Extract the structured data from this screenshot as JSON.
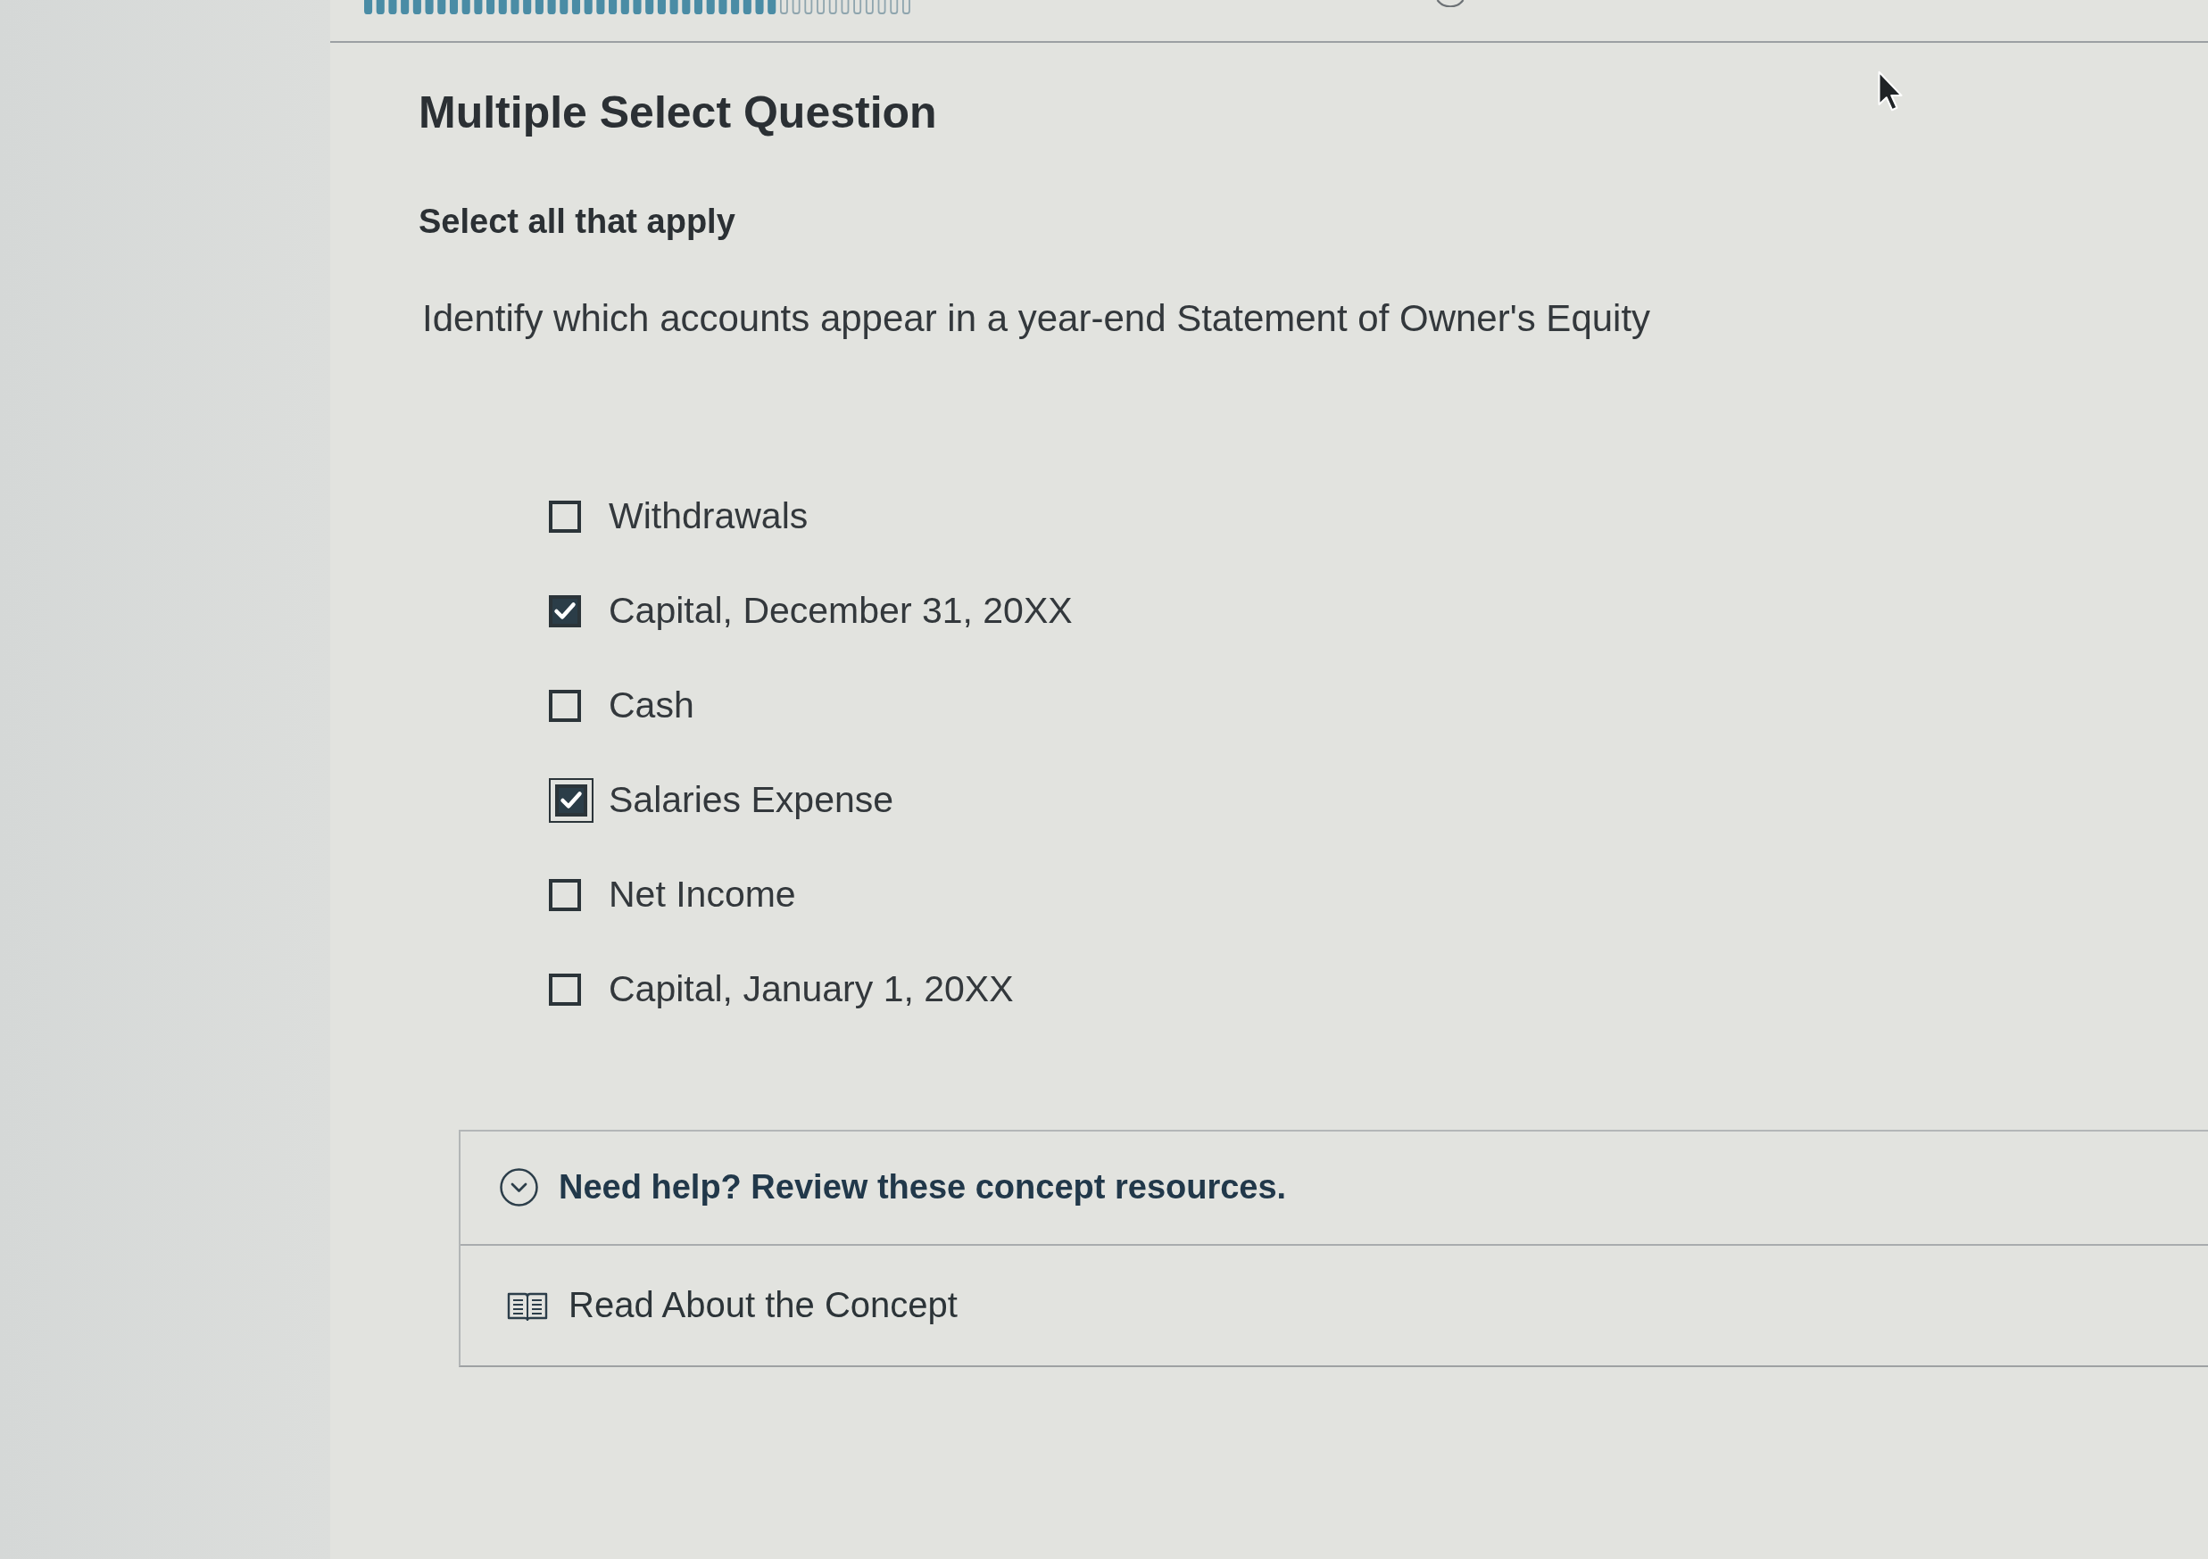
{
  "progress": {
    "level": 0.76
  },
  "title": "Multiple Select Question",
  "instruction": "Select all that apply",
  "question": "Identify which accounts appear in a year-end Statement of Owner's Equity",
  "options": [
    {
      "label": "Withdrawals",
      "checked": false,
      "focused": false
    },
    {
      "label": "Capital, December 31, 20XX",
      "checked": true,
      "focused": false
    },
    {
      "label": "Cash",
      "checked": false,
      "focused": false
    },
    {
      "label": "Salaries Expense",
      "checked": true,
      "focused": true
    },
    {
      "label": "Net Income",
      "checked": false,
      "focused": false
    },
    {
      "label": "Capital, January 1, 20XX",
      "checked": false,
      "focused": false
    }
  ],
  "help": {
    "title": "Need help? Review these concept resources.",
    "expanded": true,
    "resources": [
      {
        "kind": "reading",
        "label": "Read About the Concept"
      }
    ]
  }
}
